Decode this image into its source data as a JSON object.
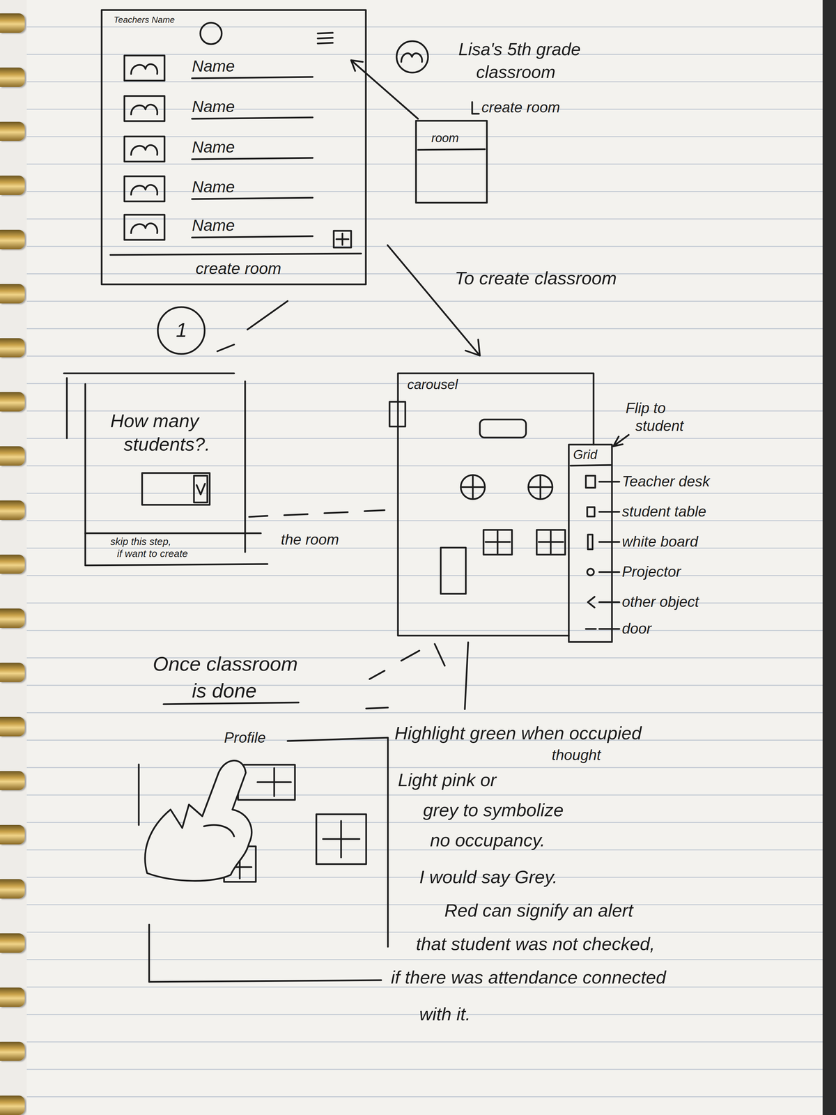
{
  "teacher_list": {
    "teacher_label": "Teachers Name",
    "rows": [
      {
        "label": "Name"
      },
      {
        "label": "Name"
      },
      {
        "label": "Name"
      },
      {
        "label": "Name"
      },
      {
        "label": "Name"
      }
    ],
    "footer": "create room"
  },
  "room_preview": {
    "title_lines": [
      "Lisa's 5th grade",
      "classroom"
    ],
    "action": "create room",
    "card_label": "room"
  },
  "flow_label": "To create classroom",
  "step_badge": "1",
  "students_dialog": {
    "question_lines": [
      "How many",
      "students?."
    ],
    "skip_lines": [
      "skip this step,",
      "if want to create"
    ],
    "continuation": "the room"
  },
  "room_editor": {
    "carousel_label": "carousel",
    "flip_lines": [
      "Flip to",
      "student"
    ],
    "palette_title": "Grid",
    "palette_items": [
      {
        "label": "Teacher desk",
        "kind": "desk"
      },
      {
        "label": "student table",
        "kind": "table"
      },
      {
        "label": "white board",
        "kind": "whiteboard"
      },
      {
        "label": "Projector",
        "kind": "projector"
      },
      {
        "label": "other object",
        "kind": "other"
      },
      {
        "label": "door",
        "kind": "door"
      }
    ]
  },
  "done_heading_lines": [
    "Once classroom",
    "is done"
  ],
  "done_view": {
    "profile_label": "Profile"
  },
  "notes": [
    "Highlight green when occupied",
    "thought",
    "Light pink or",
    "grey to symbolize",
    "no occupancy.",
    "I would say Grey.",
    "Red can signify an alert",
    "that student was not checked,",
    "if there was attendance connected",
    "with it."
  ]
}
